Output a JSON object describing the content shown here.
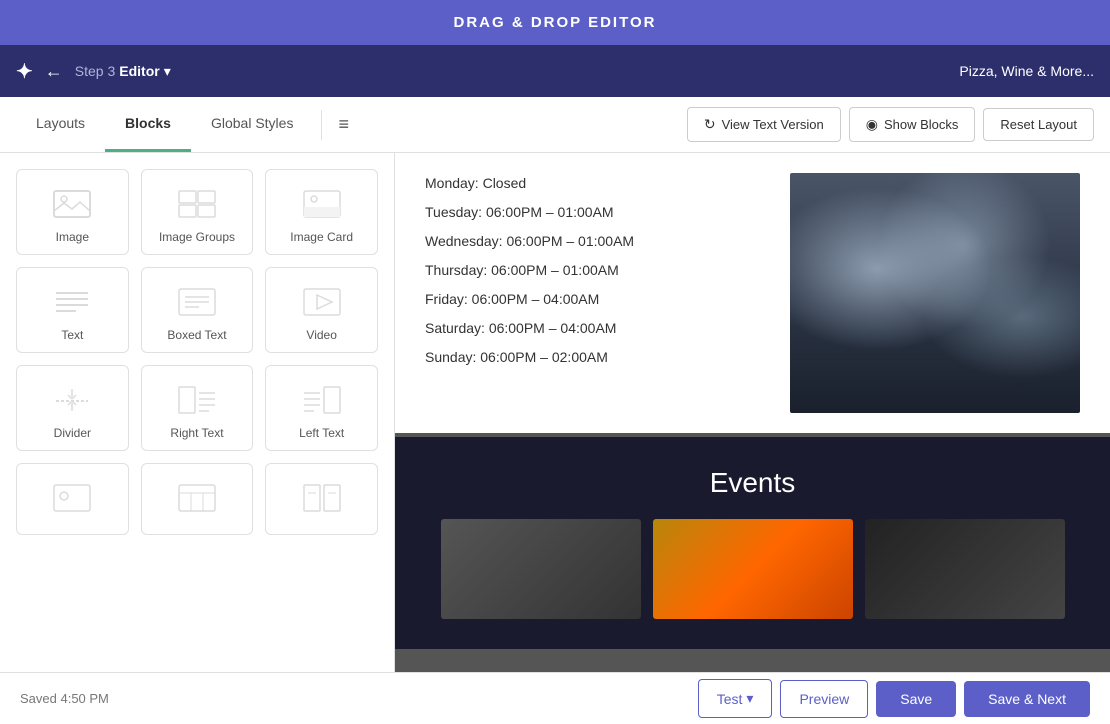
{
  "top_banner": {
    "title": "DRAG & DROP EDITOR"
  },
  "nav": {
    "step_label": "Step 3",
    "editor_label": "Editor",
    "chevron": "▾",
    "restaurant_name": "Pizza, Wine & More..."
  },
  "toolbar": {
    "tabs": [
      {
        "id": "layouts",
        "label": "Layouts",
        "active": false
      },
      {
        "id": "blocks",
        "label": "Blocks",
        "active": true
      },
      {
        "id": "global-styles",
        "label": "Global Styles",
        "active": false
      }
    ],
    "view_text_version": "View Text Version",
    "show_blocks": "Show Blocks",
    "reset_layout": "Reset Layout"
  },
  "sidebar": {
    "blocks": [
      {
        "id": "image",
        "label": "Image",
        "icon": "image"
      },
      {
        "id": "image-groups",
        "label": "Image Groups",
        "icon": "image-groups"
      },
      {
        "id": "image-card",
        "label": "Image Card",
        "icon": "image-card"
      },
      {
        "id": "text",
        "label": "Text",
        "icon": "text"
      },
      {
        "id": "boxed-text",
        "label": "Boxed Text",
        "icon": "boxed-text"
      },
      {
        "id": "video",
        "label": "Video",
        "icon": "video"
      },
      {
        "id": "divider",
        "label": "Divider",
        "icon": "divider"
      },
      {
        "id": "right-text",
        "label": "Right Text",
        "icon": "right-text"
      },
      {
        "id": "left-text",
        "label": "Left Text",
        "icon": "left-text"
      },
      {
        "id": "unknown1",
        "label": "",
        "icon": "image2"
      },
      {
        "id": "unknown2",
        "label": "",
        "icon": "table"
      },
      {
        "id": "unknown3",
        "label": "",
        "icon": "social"
      }
    ]
  },
  "content": {
    "hours": [
      "Monday: Closed",
      "Tuesday: 06:00PM – 01:00AM",
      "Wednesday: 06:00PM – 01:00AM",
      "Thursday: 06:00PM – 01:00AM",
      "Friday: 06:00PM – 04:00AM",
      "Saturday: 06:00PM – 04:00AM",
      "Sunday: 06:00PM – 02:00AM"
    ],
    "events_title": "Events"
  },
  "footer": {
    "saved_text": "Saved 4:50 PM",
    "test_label": "Test",
    "preview_label": "Preview",
    "save_label": "Save",
    "save_next_label": "Save & Next"
  }
}
